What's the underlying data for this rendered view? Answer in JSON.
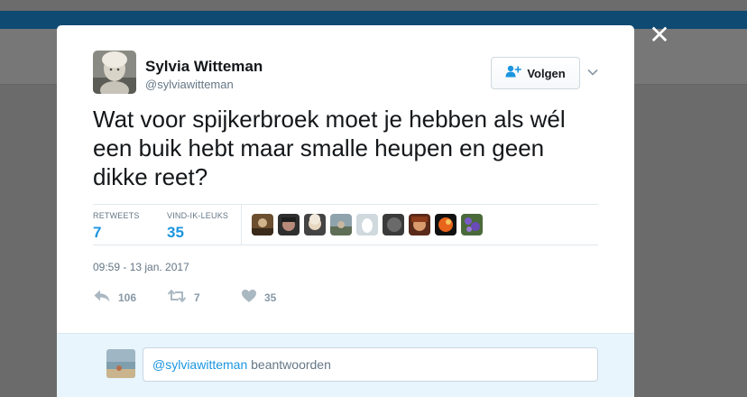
{
  "close_icon": "close-icon",
  "tweet": {
    "author_name": "Sylvia Witteman",
    "author_handle": "@sylviawitteman",
    "follow_label": "Volgen",
    "text": "Wat voor spijkerbroek moet je hebben als wél een buik hebt maar smalle heupen en geen dikke reet?",
    "stats": {
      "retweets_label": "RETWEETS",
      "retweets_value": "7",
      "likes_label": "VIND-IK-LEUKS",
      "likes_value": "35"
    },
    "likers_count": 9,
    "timestamp": "09:59 - 13 jan. 2017",
    "actions": {
      "reply_count": "106",
      "retweet_count": "7",
      "like_count": "35"
    }
  },
  "reply": {
    "mention": "@sylviawitteman",
    "placeholder_rest": " beantwoorden"
  },
  "colors": {
    "accent": "#1b95e0",
    "overlay": "#6f6f6f",
    "bluebar": "#0f4a73"
  }
}
